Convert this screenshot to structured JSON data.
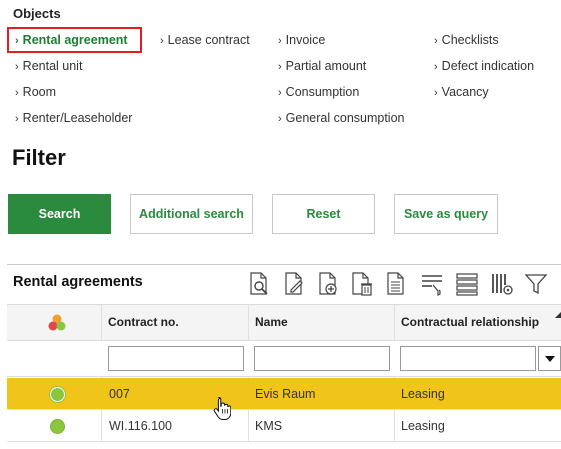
{
  "objects": {
    "title": "Objects",
    "links": [
      {
        "label": "Rental agreement",
        "active": true
      },
      {
        "label": "Lease contract"
      },
      {
        "label": "Invoice"
      },
      {
        "label": "Checklists"
      },
      {
        "label": "Rental unit"
      },
      {
        "label": "Partial amount"
      },
      {
        "label": "Defect indication"
      },
      {
        "label": "Room"
      },
      {
        "label": "Consumption"
      },
      {
        "label": "Vacancy"
      },
      {
        "label": "Renter/Leaseholder"
      },
      {
        "label": "General consumption"
      }
    ]
  },
  "filter": {
    "title": "Filter",
    "buttons": {
      "search": "Search",
      "additional_search": "Additional search",
      "reset": "Reset",
      "save_as_query": "Save as query"
    }
  },
  "grid": {
    "title": "Rental agreements",
    "toolbar_icons": [
      "view-document-icon",
      "edit-document-icon",
      "add-document-icon",
      "delete-document-icon",
      "document-icon",
      "filter-rows-icon",
      "list-icon",
      "column-settings-icon",
      "funnel-icon"
    ],
    "columns": {
      "status": "status-icon",
      "contract_no": "Contract no.",
      "name": "Name",
      "relationship": "Contractual relationship"
    },
    "filter_values": {
      "contract_no": "",
      "name": "",
      "relationship": ""
    },
    "rows": [
      {
        "contract_no": "007",
        "name": "Evis Raum",
        "relationship": "Leasing",
        "selected": true
      },
      {
        "contract_no": "WI.116.100",
        "name": "KMS",
        "relationship": "Leasing",
        "selected": false
      }
    ]
  },
  "colors": {
    "accent_green": "#2a8a3e",
    "active_link": "#1e7e34",
    "highlight_box": "#e02020",
    "selected_row": "#f0c419",
    "status_dot": "#8cc63f"
  }
}
